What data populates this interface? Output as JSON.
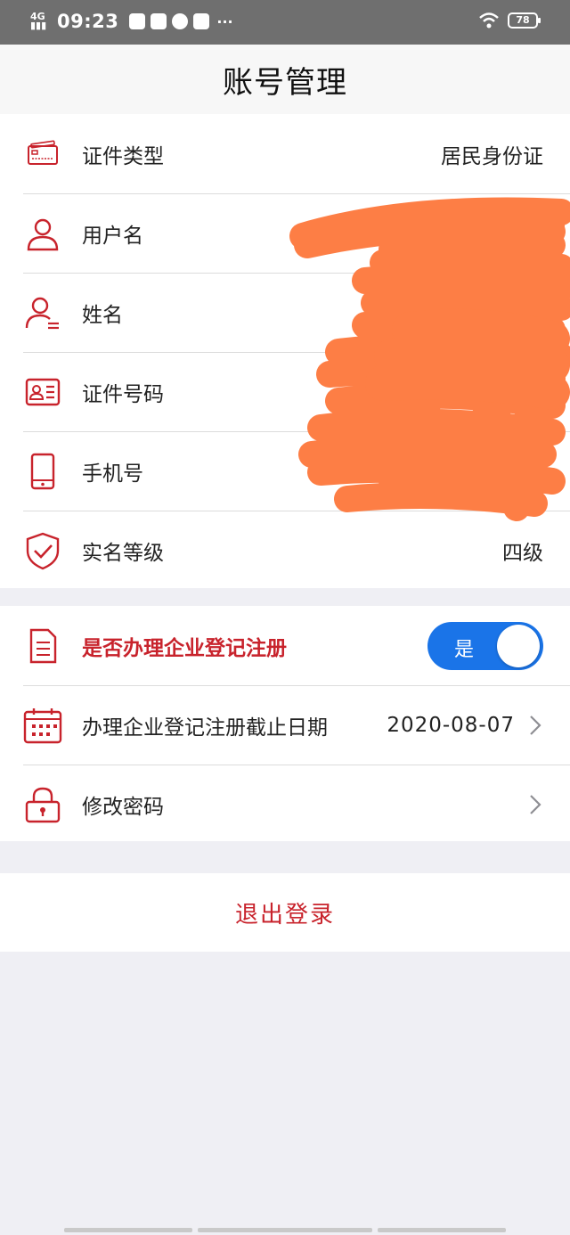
{
  "status_bar": {
    "network": "4G",
    "time": "09:23",
    "more": "···",
    "battery": "78"
  },
  "header": {
    "title": "账号管理"
  },
  "account_section": {
    "items": [
      {
        "label": "证件类型",
        "value": "居民身份证",
        "icon": "id-card-icon"
      },
      {
        "label": "用户名",
        "value": "",
        "icon": "user-icon"
      },
      {
        "label": "姓名",
        "value": "",
        "icon": "user-name-icon"
      },
      {
        "label": "证件号码",
        "value": "",
        "icon": "id-number-icon"
      },
      {
        "label": "手机号",
        "value": "",
        "icon": "phone-icon"
      },
      {
        "label": "实名等级",
        "value": "四级",
        "icon": "shield-check-icon"
      }
    ]
  },
  "business_section": {
    "registration_label": "是否办理企业登记注册",
    "registration_toggle": {
      "state": "on",
      "text": "是"
    },
    "deadline_label": "办理企业登记注册截止日期",
    "deadline_value": "2020-08-07",
    "password_label": "修改密码"
  },
  "logout": {
    "label": "退出登录"
  },
  "colors": {
    "accent_red": "#c8232c",
    "toggle_blue": "#1a74e8",
    "redaction_orange": "#fd7e45"
  }
}
